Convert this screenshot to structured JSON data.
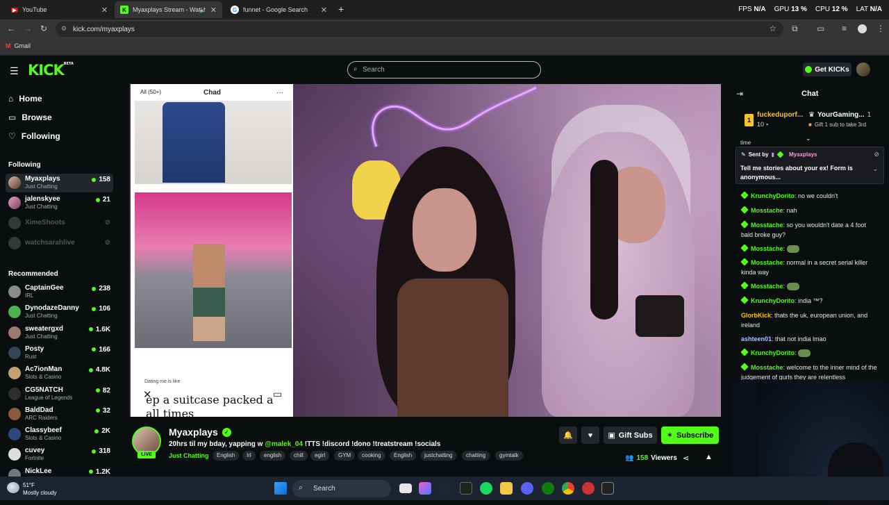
{
  "browser": {
    "tabs": [
      {
        "title": "YouTube",
        "icon": "youtube-icon"
      },
      {
        "title": "Myaxplays Stream - Watch",
        "icon": "kick-icon"
      },
      {
        "title": "funnet - Google Search",
        "icon": "google-icon"
      }
    ],
    "url": "kick.com/myaxplays",
    "bookmark": "Gmail",
    "perf": {
      "fps_label": "FPS",
      "fps": "N/A",
      "gpu_label": "GPU",
      "gpu": "13 %",
      "cpu_label": "CPU",
      "cpu": "12 %",
      "lat_label": "LAT",
      "lat": "N/A"
    }
  },
  "header": {
    "logo": "KICK",
    "logo_tag": "BETA",
    "search_placeholder": "Search",
    "get_kicks": "Get KICKs"
  },
  "sidebar": {
    "nav": [
      "Home",
      "Browse",
      "Following"
    ],
    "following_heading": "Following",
    "following": [
      {
        "name": "Myaxplays",
        "category": "Just Chatting",
        "viewers": "158",
        "live": true
      },
      {
        "name": "jalenskyee",
        "category": "Just Chatting",
        "viewers": "21",
        "live": true
      },
      {
        "name": "XimeShoots",
        "category": "",
        "viewers": "",
        "live": false
      },
      {
        "name": "watchsarahlive",
        "category": "",
        "viewers": "",
        "live": false
      }
    ],
    "recommended_heading": "Recommended",
    "recommended": [
      {
        "name": "CaptainGee",
        "category": "IRL",
        "viewers": "238"
      },
      {
        "name": "DynodazeDanny",
        "category": "Just Chatting",
        "viewers": "106"
      },
      {
        "name": "sweatergxd",
        "category": "Just Chatting",
        "viewers": "1.6K"
      },
      {
        "name": "Posty",
        "category": "Rust",
        "viewers": "166"
      },
      {
        "name": "Ac7ionMan",
        "category": "Slots & Casino",
        "viewers": "4.8K"
      },
      {
        "name": "CG5NATCH",
        "category": "League of Legends",
        "viewers": "82"
      },
      {
        "name": "BaldDad",
        "category": "ARC Raiders",
        "viewers": "32"
      },
      {
        "name": "Classybeef",
        "category": "Slots & Casino",
        "viewers": "2K"
      },
      {
        "name": "cuvey",
        "category": "Fortnite",
        "viewers": "318"
      },
      {
        "name": "NickLee",
        "category": "",
        "viewers": "1.2K"
      }
    ]
  },
  "video": {
    "phone_tab_all": "All (50+)",
    "phone_tab_title": "Chad",
    "phone_small_text": "Dating me is like",
    "phone_big_text": "ep a suitcase packed a",
    "phone_big_text2": "all times"
  },
  "stream": {
    "name": "Myaxplays",
    "live": "LIVE",
    "title_prefix": "20hrs til my bday, yapping w",
    "title_mention": "@malek_04",
    "title_suffix": "!TTS !discord !dono !treatstream !socials",
    "category": "Just Chatting",
    "tags": [
      "English",
      "Irl",
      "english",
      "chill",
      "egirl",
      "GYM",
      "cooking",
      "English",
      "justchatting",
      "chatting",
      "gymtalk"
    ],
    "gift_subs": "Gift Subs",
    "subscribe": "Subscribe",
    "viewers": "158",
    "viewers_label": "Viewers"
  },
  "chat": {
    "title": "Chat",
    "gift_rank": "1",
    "gift_user": "fuckeduporf...",
    "gift_count": "10",
    "gift_user2": "YourGaming...",
    "gift_user2_count": "1",
    "gift_cta": "Gift 1 sub to take 3rd",
    "partial_line": "time",
    "pinned_sent_by": "Sent by",
    "pinned_user": "Myaxplays",
    "pinned_text": "Tell me stories about your ex! Form is anonymous...",
    "messages": [
      {
        "user": "KrunchyDorito",
        "color": "#53fc18",
        "badge": true,
        "text": "no we couldn't"
      },
      {
        "user": "Mosstache",
        "color": "#53fc18",
        "badge": true,
        "text": "nah"
      },
      {
        "user": "Mosstache",
        "color": "#53fc18",
        "badge": true,
        "text": "so you wouldn't date a 4 foot bald broke guy?"
      },
      {
        "user": "Mosstache",
        "color": "#53fc18",
        "badge": true,
        "text": ""
      },
      {
        "user": "Mosstache",
        "color": "#53fc18",
        "badge": true,
        "text": "normal in a secret serial killer kinda way"
      },
      {
        "user": "Mosstache",
        "color": "#53fc18",
        "badge": true,
        "text": ""
      },
      {
        "user": "KrunchyDorito",
        "color": "#53fc18",
        "badge": true,
        "text": "india ™?"
      },
      {
        "user": "GlorbKick",
        "color": "#ffc400",
        "badge": false,
        "text": "thats the uk, european union, and ireland"
      },
      {
        "user": "ashteen01",
        "color": "#a7c7ff",
        "badge": false,
        "text": "that not india lmao"
      },
      {
        "user": "KrunchyDorito",
        "color": "#53fc18",
        "badge": true,
        "text": ""
      },
      {
        "user": "Mosstache",
        "color": "#53fc18",
        "badge": true,
        "text": "welcome to the inner mind of the judgement of gurls they are relentless"
      }
    ]
  },
  "taskbar": {
    "weather_temp": "51°F",
    "weather_desc": "Mostly cloudy",
    "search": "Search"
  }
}
